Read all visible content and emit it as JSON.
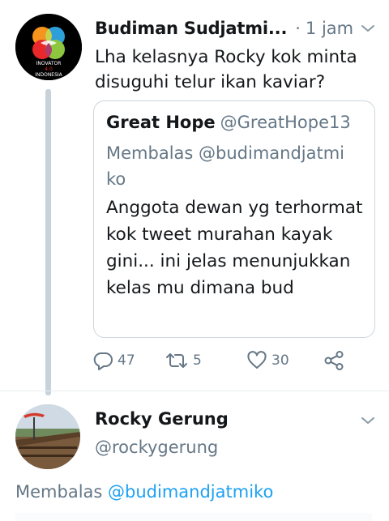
{
  "tweet1": {
    "author_name": "Budiman Sudjatmi...",
    "separator": "·",
    "time": "1 jam",
    "avatar_text": [
      "INOVATOR",
      "4.0",
      "INDONESIA"
    ],
    "text": "Lha kelasnya Rocky kok minta disuguhi telur ikan kaviar?",
    "quoted": {
      "author_name": "Great Hope",
      "author_handle": "@GreatHope13",
      "reply_context": "Membalas @budimandjatmi ko",
      "text": "Anggota dewan yg terhormat kok tweet murahan kayak gini... ini jelas menunjukkan kelas mu dimana bud"
    },
    "actions": {
      "reply_count": "47",
      "retweet_count": "5",
      "like_count": "30"
    }
  },
  "tweet2": {
    "author_name": "Rocky Gerung",
    "author_handle": "@rockygerung",
    "reply_label": "Membalas",
    "reply_mention": "@budimandjatmiko"
  },
  "icons": {
    "reply": "reply-icon",
    "retweet": "retweet-icon",
    "like": "heart-icon",
    "share": "share-icon",
    "menu": "chevron-down-icon"
  },
  "colors": {
    "text": "#14171a",
    "secondary": "#657786",
    "link": "#1da1f2",
    "border": "#cdd6dd",
    "thread_line": "#c8d2da"
  }
}
